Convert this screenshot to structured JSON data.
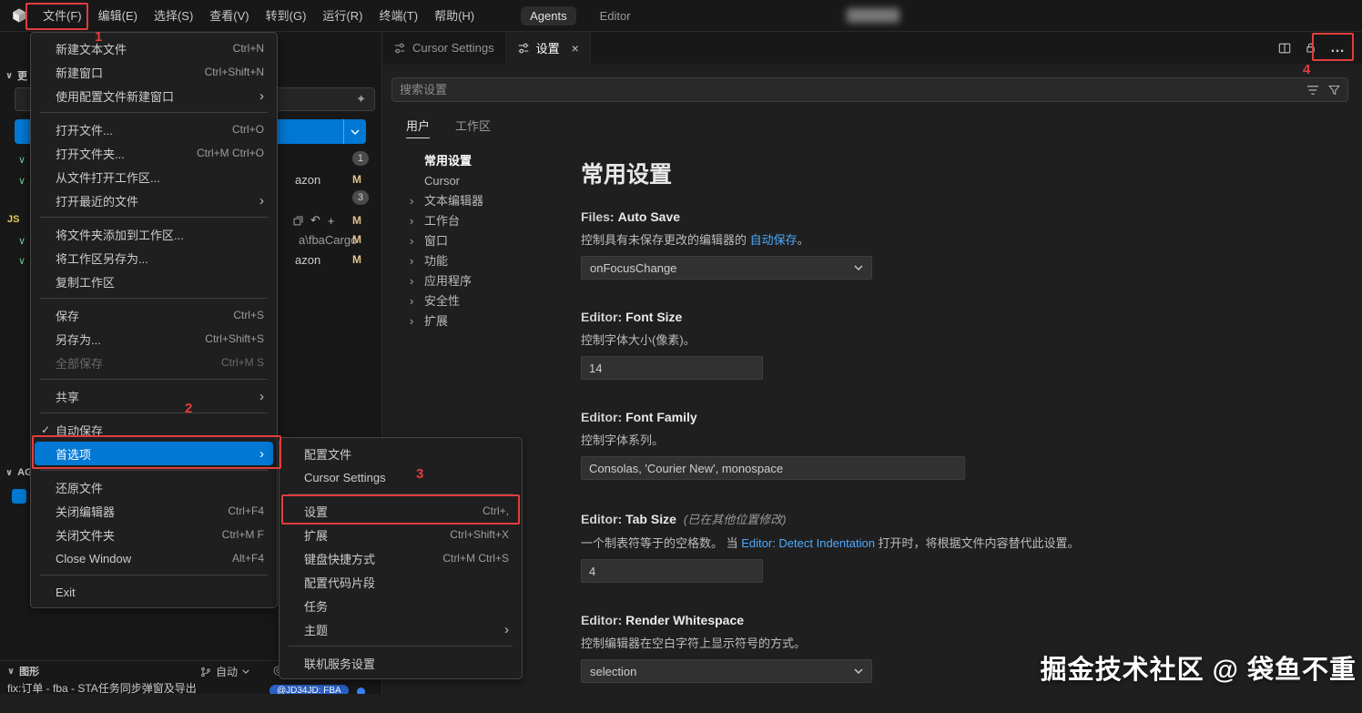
{
  "colors": {
    "accent": "#0078d4",
    "link": "#4daafc",
    "annotation": "#e13d3d",
    "modified": "#e2c08d"
  },
  "icons": {
    "submenu_arrow": "›",
    "check": "✓",
    "close": "×",
    "more": "…",
    "chevron_down": "∨",
    "sparkle": "✦",
    "discard": "↶",
    "plus": "+",
    "graph": [
      "◎",
      "⊗",
      "⊘",
      "⊕",
      "↻"
    ]
  },
  "titlebar": {
    "menus": [
      "文件(F)",
      "编辑(E)",
      "选择(S)",
      "查看(V)",
      "转到(G)",
      "运行(R)",
      "终端(T)",
      "帮助(H)"
    ],
    "tabs": [
      "Agents",
      "Editor"
    ]
  },
  "file_menu": {
    "items": [
      {
        "label": "新建文本文件",
        "shortcut": "Ctrl+N"
      },
      {
        "label": "新建窗口",
        "shortcut": "Ctrl+Shift+N"
      },
      {
        "label": "使用配置文件新建窗口",
        "submenu": true
      },
      {
        "label": "打开文件...",
        "shortcut": "Ctrl+O"
      },
      {
        "label": "打开文件夹...",
        "shortcut": "Ctrl+M Ctrl+O"
      },
      {
        "label": "从文件打开工作区..."
      },
      {
        "label": "打开最近的文件",
        "submenu": true
      },
      {
        "label": "将文件夹添加到工作区..."
      },
      {
        "label": "将工作区另存为..."
      },
      {
        "label": "复制工作区"
      },
      {
        "label": "保存",
        "shortcut": "Ctrl+S"
      },
      {
        "label": "另存为...",
        "shortcut": "Ctrl+Shift+S"
      },
      {
        "label": "全部保存",
        "shortcut": "Ctrl+M S",
        "disabled": true
      },
      {
        "label": "共享",
        "submenu": true
      },
      {
        "label": "自动保存",
        "checked": true
      },
      {
        "label": "首选项",
        "submenu": true,
        "highlighted": true
      },
      {
        "label": "还原文件"
      },
      {
        "label": "关闭编辑器",
        "shortcut": "Ctrl+F4"
      },
      {
        "label": "关闭文件夹",
        "shortcut": "Ctrl+M F"
      },
      {
        "label": "Close Window",
        "shortcut": "Alt+F4"
      },
      {
        "label": "Exit"
      }
    ]
  },
  "preferences_menu": {
    "items": [
      {
        "label": "配置文件"
      },
      {
        "label": "Cursor Settings"
      },
      {
        "label": "设置",
        "shortcut": "Ctrl+,"
      },
      {
        "label": "扩展",
        "shortcut": "Ctrl+Shift+X"
      },
      {
        "label": "键盘快捷方式",
        "shortcut": "Ctrl+M Ctrl+S"
      },
      {
        "label": "配置代码片段"
      },
      {
        "label": "任务"
      },
      {
        "label": "主题",
        "submenu": true
      },
      {
        "label": "联机服务设置"
      }
    ]
  },
  "editor": {
    "tabs": [
      {
        "label": "Cursor Settings"
      },
      {
        "label": "设置",
        "active": true
      }
    ]
  },
  "settings": {
    "search_placeholder": "搜索设置",
    "scope_tabs": [
      "用户",
      "工作区"
    ],
    "toc": [
      "常用设置",
      "Cursor",
      "文本编辑器",
      "工作台",
      "窗口",
      "功能",
      "应用程序",
      "安全性",
      "扩展"
    ],
    "title": "常用设置",
    "items": [
      {
        "category": "Files:",
        "name": "Auto Save",
        "desc_before": "控制具有未保存更改的编辑器的 ",
        "desc_link": "自动保存",
        "desc_after": "。",
        "value": "onFocusChange"
      },
      {
        "category": "Editor:",
        "name": "Font Size",
        "desc_before": "控制字体大小(像素)。",
        "value": "14"
      },
      {
        "category": "Editor:",
        "name": "Font Family",
        "desc_before": "控制字体系列。",
        "value": "Consolas, 'Courier New', monospace"
      },
      {
        "category": "Editor:",
        "name": "Tab Size",
        "note": "(已在其他位置修改)",
        "desc_before": "一个制表符等于的空格数。 当 ",
        "desc_link": "Editor: Detect Indentation",
        "desc_after": " 打开时，将根据文件内容替代此设置。",
        "value": "4"
      },
      {
        "category": "Editor:",
        "name": "Render Whitespace",
        "desc_before": "控制编辑器在空白字符上显示符号的方式。",
        "value": "selection"
      }
    ]
  },
  "sidebar": {
    "changes_header": "更",
    "badge_1": "1",
    "badge_2": "3",
    "file_row_1": "azon",
    "file_row_2": "a\\fbaCargo",
    "file_row_3": "azon",
    "modified_badge": "M",
    "js_badge": "JS",
    "ag_header": "AG",
    "graph_header": "图形",
    "graph_auto": "自动",
    "commit_message": "fix:订单 - fba - STA任务同步弹窗及导出",
    "branch_badge": "@JD34JD: FBA"
  },
  "annotations": {
    "step1": "1",
    "step2": "2",
    "step3": "3",
    "step4": "4"
  },
  "watermark": "掘金技术社区 @ 袋鱼不重"
}
